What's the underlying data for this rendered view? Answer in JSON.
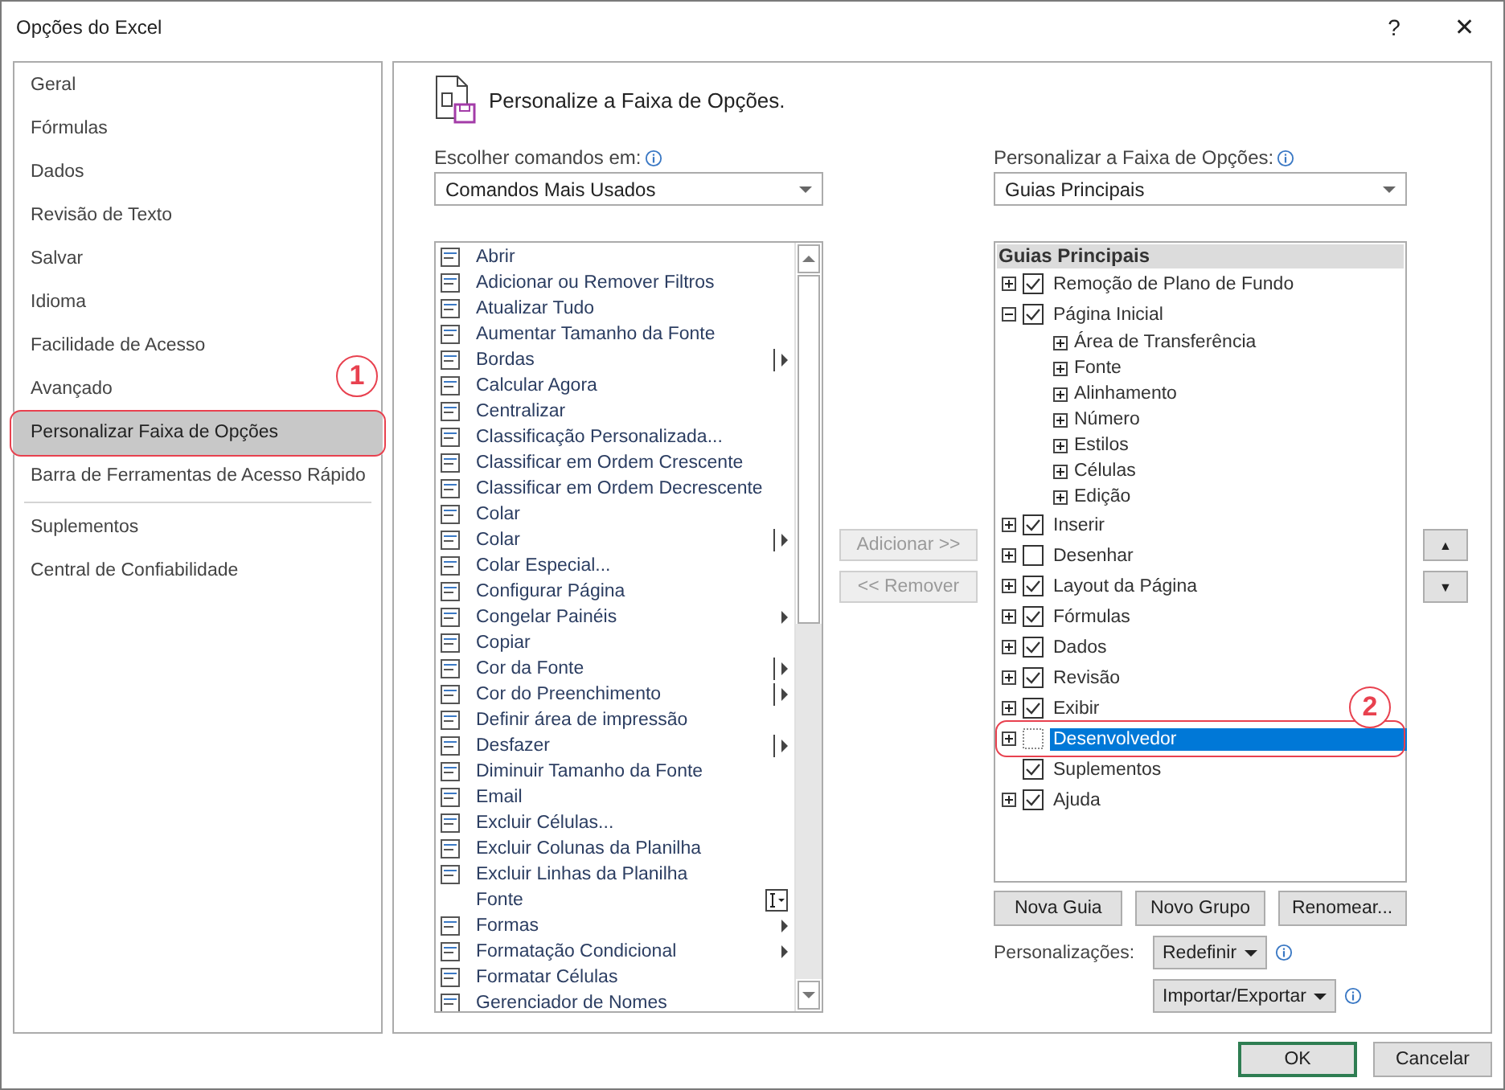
{
  "window": {
    "title": "Opções do Excel",
    "help": "?",
    "close": "✕"
  },
  "sidebar": {
    "groups": [
      {
        "items": [
          {
            "label": "Geral",
            "selected": false
          },
          {
            "label": "Fórmulas",
            "selected": false
          },
          {
            "label": "Dados",
            "selected": false
          },
          {
            "label": "Revisão de Texto",
            "selected": false
          },
          {
            "label": "Salvar",
            "selected": false
          },
          {
            "label": "Idioma",
            "selected": false
          },
          {
            "label": "Facilidade de Acesso",
            "selected": false
          },
          {
            "label": "Avançado",
            "selected": false
          },
          {
            "label": "Personalizar Faixa de Opções",
            "selected": true,
            "annotation": "1"
          },
          {
            "label": "Barra de Ferramentas de Acesso Rápido",
            "selected": false
          }
        ]
      },
      {
        "items": [
          {
            "label": "Suplementos",
            "selected": false
          },
          {
            "label": "Central de Confiabilidade",
            "selected": false
          }
        ]
      }
    ]
  },
  "header": {
    "title": "Personalize a Faixa de Opções."
  },
  "commands": {
    "label": "Escolher comandos em:",
    "dropdown": {
      "value": "Comandos Mais Usados"
    },
    "items": [
      {
        "label": "Abrir",
        "icon": true,
        "kind": "plain"
      },
      {
        "label": "Adicionar ou Remover Filtros",
        "icon": true,
        "kind": "plain"
      },
      {
        "label": "Atualizar Tudo",
        "icon": true,
        "kind": "plain"
      },
      {
        "label": "Aumentar Tamanho da Fonte",
        "icon": true,
        "kind": "plain"
      },
      {
        "label": "Bordas",
        "icon": true,
        "kind": "split"
      },
      {
        "label": "Calcular Agora",
        "icon": true,
        "kind": "plain"
      },
      {
        "label": "Centralizar",
        "icon": true,
        "kind": "plain"
      },
      {
        "label": "Classificação Personalizada...",
        "icon": true,
        "kind": "plain"
      },
      {
        "label": "Classificar em Ordem Crescente",
        "icon": true,
        "kind": "plain"
      },
      {
        "label": "Classificar em Ordem Decrescente",
        "icon": true,
        "kind": "plain"
      },
      {
        "label": "Colar",
        "icon": true,
        "kind": "plain"
      },
      {
        "label": "Colar",
        "icon": true,
        "kind": "split"
      },
      {
        "label": "Colar Especial...",
        "icon": true,
        "kind": "plain"
      },
      {
        "label": "Configurar Página",
        "icon": true,
        "kind": "plain"
      },
      {
        "label": "Congelar Painéis",
        "icon": true,
        "kind": "arrow"
      },
      {
        "label": "Copiar",
        "icon": true,
        "kind": "plain"
      },
      {
        "label": "Cor da Fonte",
        "icon": true,
        "kind": "split"
      },
      {
        "label": "Cor do Preenchimento",
        "icon": true,
        "kind": "split"
      },
      {
        "label": "Definir área de impressão",
        "icon": true,
        "kind": "plain"
      },
      {
        "label": "Desfazer",
        "icon": true,
        "kind": "split"
      },
      {
        "label": "Diminuir Tamanho da Fonte",
        "icon": true,
        "kind": "plain"
      },
      {
        "label": "Email",
        "icon": true,
        "kind": "plain"
      },
      {
        "label": "Excluir Células...",
        "icon": true,
        "kind": "plain"
      },
      {
        "label": "Excluir Colunas da Planilha",
        "icon": true,
        "kind": "plain"
      },
      {
        "label": "Excluir Linhas da Planilha",
        "icon": true,
        "kind": "plain"
      },
      {
        "label": "Fonte",
        "icon": false,
        "kind": "field"
      },
      {
        "label": "Formas",
        "icon": true,
        "kind": "arrow"
      },
      {
        "label": "Formatação Condicional",
        "icon": true,
        "kind": "arrow"
      },
      {
        "label": "Formatar Células",
        "icon": true,
        "kind": "plain"
      },
      {
        "label": "Gerenciador de Nomes",
        "icon": true,
        "kind": "plain"
      }
    ]
  },
  "add_button": {
    "label": "Adicionar >>",
    "disabled": true
  },
  "remove_button": {
    "label": "<< Remover",
    "disabled": true
  },
  "ribbon": {
    "label": "Personalizar a Faixa de Opções:",
    "dropdown": {
      "value": "Guias Principais"
    },
    "tree_heading": "Guias Principais",
    "tabs": [
      {
        "label": "Remoção de Plano de Fundo",
        "checked": true,
        "expandable": true,
        "expanded": false,
        "selected": false
      },
      {
        "label": "Página Inicial",
        "checked": true,
        "expandable": true,
        "expanded": true,
        "selected": false,
        "children": [
          {
            "label": "Área de Transferência"
          },
          {
            "label": "Fonte"
          },
          {
            "label": "Alinhamento"
          },
          {
            "label": "Número"
          },
          {
            "label": "Estilos"
          },
          {
            "label": "Células"
          },
          {
            "label": "Edição"
          }
        ]
      },
      {
        "label": "Inserir",
        "checked": true,
        "expandable": true,
        "expanded": false,
        "selected": false
      },
      {
        "label": "Desenhar",
        "checked": false,
        "expandable": true,
        "expanded": false,
        "selected": false
      },
      {
        "label": "Layout da Página",
        "checked": true,
        "expandable": true,
        "expanded": false,
        "selected": false
      },
      {
        "label": "Fórmulas",
        "checked": true,
        "expandable": true,
        "expanded": false,
        "selected": false
      },
      {
        "label": "Dados",
        "checked": true,
        "expandable": true,
        "expanded": false,
        "selected": false
      },
      {
        "label": "Revisão",
        "checked": true,
        "expandable": true,
        "expanded": false,
        "selected": false
      },
      {
        "label": "Exibir",
        "checked": true,
        "expandable": true,
        "expanded": false,
        "selected": false
      },
      {
        "label": "Desenvolvedor",
        "checked": false,
        "expandable": true,
        "expanded": false,
        "selected": true,
        "annotation": "2"
      },
      {
        "label": "Suplementos",
        "checked": true,
        "expandable": false,
        "expanded": false,
        "selected": false
      },
      {
        "label": "Ajuda",
        "checked": true,
        "expandable": true,
        "expanded": false,
        "selected": false
      }
    ],
    "buttons": [
      "Nova Guia",
      "Novo Grupo",
      "Renomear..."
    ],
    "customizations_label": "Personalizações:",
    "reset_button": "Redefinir",
    "import_export_button": "Importar/Exportar"
  },
  "move_buttons": {
    "up": "▲",
    "down": "▼"
  },
  "footer": {
    "ok": "OK",
    "cancel": "Cancelar"
  }
}
